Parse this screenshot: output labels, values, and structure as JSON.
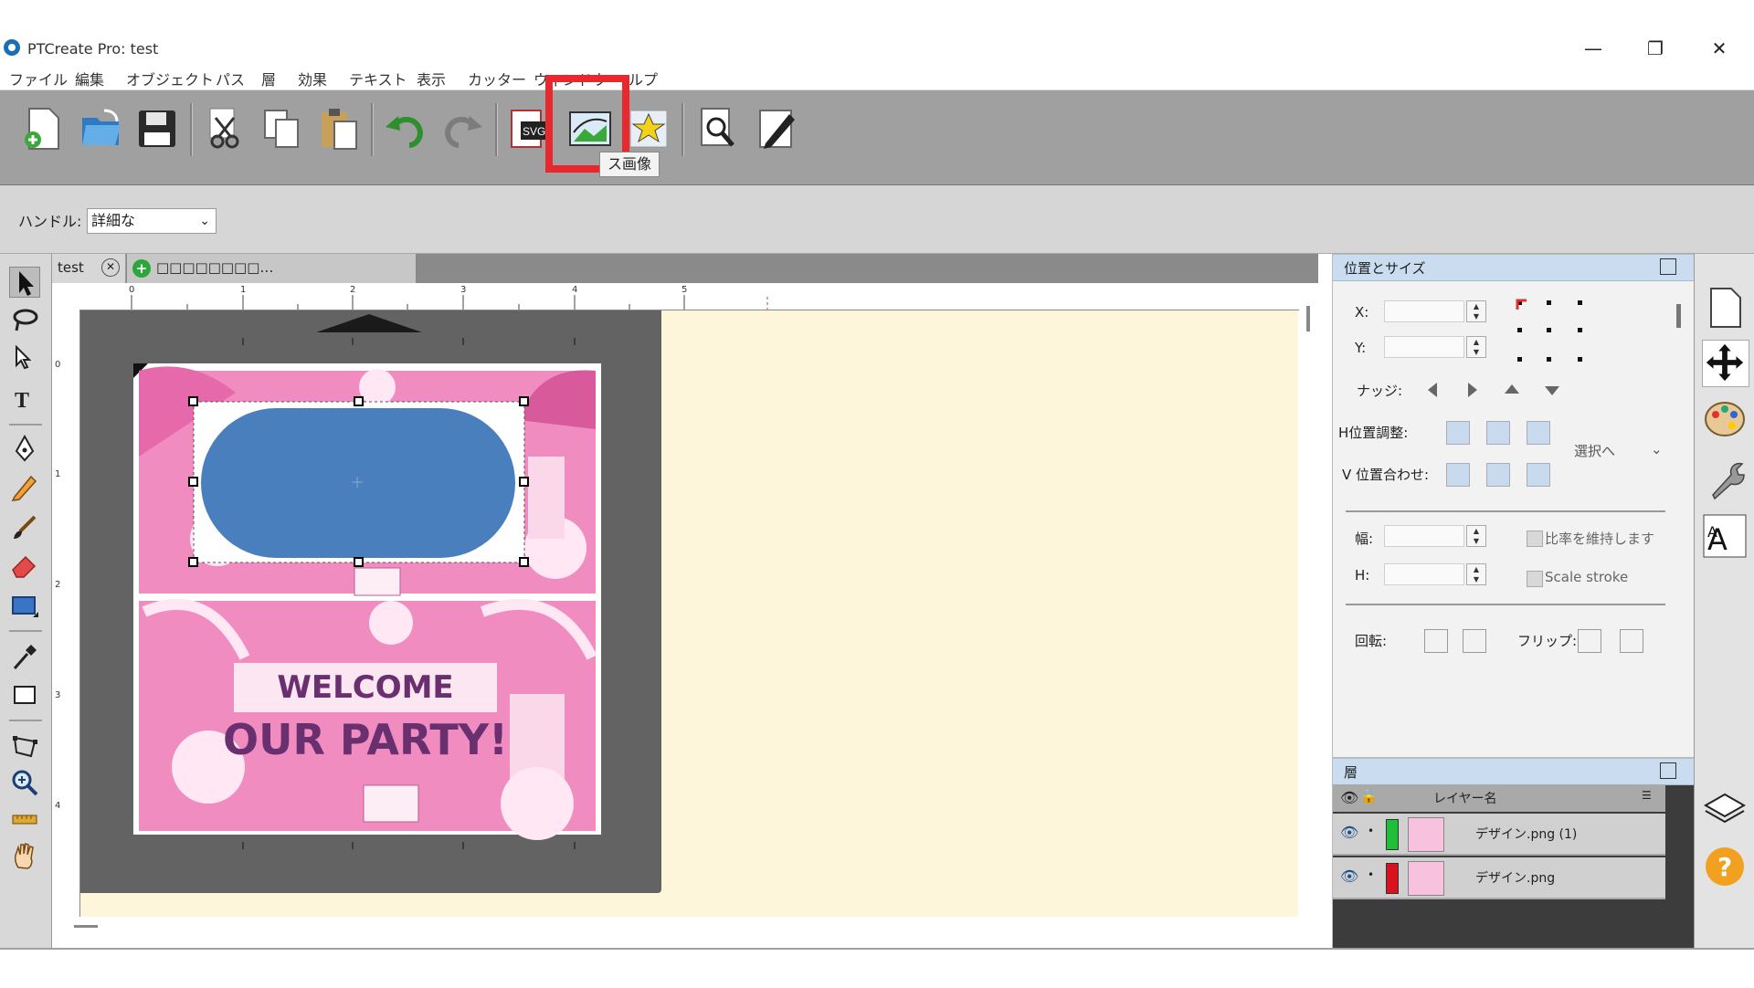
{
  "window": {
    "title": "PTCreate Pro: test"
  },
  "menu": [
    "ファイル",
    "編集",
    "オブジェクト",
    "パス",
    "層",
    "効果",
    "テキスト",
    "表示",
    "カッター",
    "ウィンドウ",
    "ヘルプ"
  ],
  "toolbar": {
    "tooltip": "ス画像"
  },
  "handle": {
    "label": "ハンドル:",
    "value": "詳細な"
  },
  "tabs": {
    "doc": "test",
    "new": "□□□□□□□□…"
  },
  "ruler": {
    "top": [
      "0",
      "1",
      "2",
      "3",
      "4",
      "5"
    ],
    "left": [
      "0",
      "1",
      "2",
      "3",
      "4"
    ]
  },
  "design": {
    "line1": "WELCOME",
    "line2": "OUR PARTY!"
  },
  "position_panel": {
    "title": "位置とサイズ",
    "x_label": "X:",
    "y_label": "Y:",
    "nudge_label": "ナッジ:",
    "h_align_label": "H位置調整:",
    "v_align_label": "V 位置合わせ:",
    "align_to": "選択へ",
    "width_label": "幅:",
    "height_label": "H:",
    "keep_ratio": "比率を維持します",
    "scale_stroke": "Scale stroke",
    "rotate_label": "回転:",
    "flip_label": "フリップ:"
  },
  "layers_panel": {
    "title": "層",
    "column": "レイヤー名",
    "rows": [
      {
        "name": "デザイン.png (1)",
        "color": "#1fbf3a"
      },
      {
        "name": "デザイン.png",
        "color": "#d8131f"
      }
    ]
  },
  "colors": {
    "highlight": "#e8282c",
    "shape": "#4a7fbd",
    "card": "#f08cc0",
    "canvas": "#fdf6da"
  }
}
